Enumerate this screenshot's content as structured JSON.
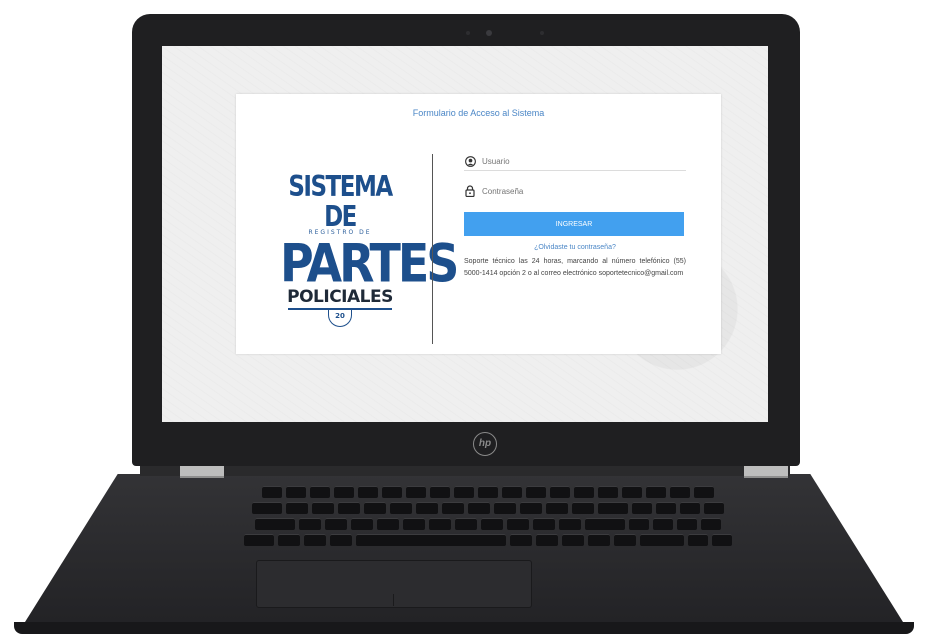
{
  "device": {
    "brand_logo": "hp"
  },
  "login": {
    "title": "Formulario de Acceso al Sistema",
    "brand": {
      "line1": "SISTEMA DE",
      "line2": "REGISTRO DE",
      "line3": "PARTES",
      "line4": "POLICIALES",
      "seal": "20"
    },
    "username_placeholder": "Usuario",
    "password_placeholder": "Contraseña",
    "submit_label": "INGRESAR",
    "forgot_link": "¿Olvidaste tu contraseña?",
    "info_text": "Soporte técnico las 24 horas, marcando al número telefónico (55) 5000-1414 opción 2 o al correo electrónico soportetecnico@gmail.com"
  },
  "colors": {
    "accent": "#42a0ef",
    "brand_blue": "#1d4f8c",
    "link": "#4a86c6"
  },
  "icons": {
    "user": "user-icon",
    "lock": "lock-icon"
  }
}
